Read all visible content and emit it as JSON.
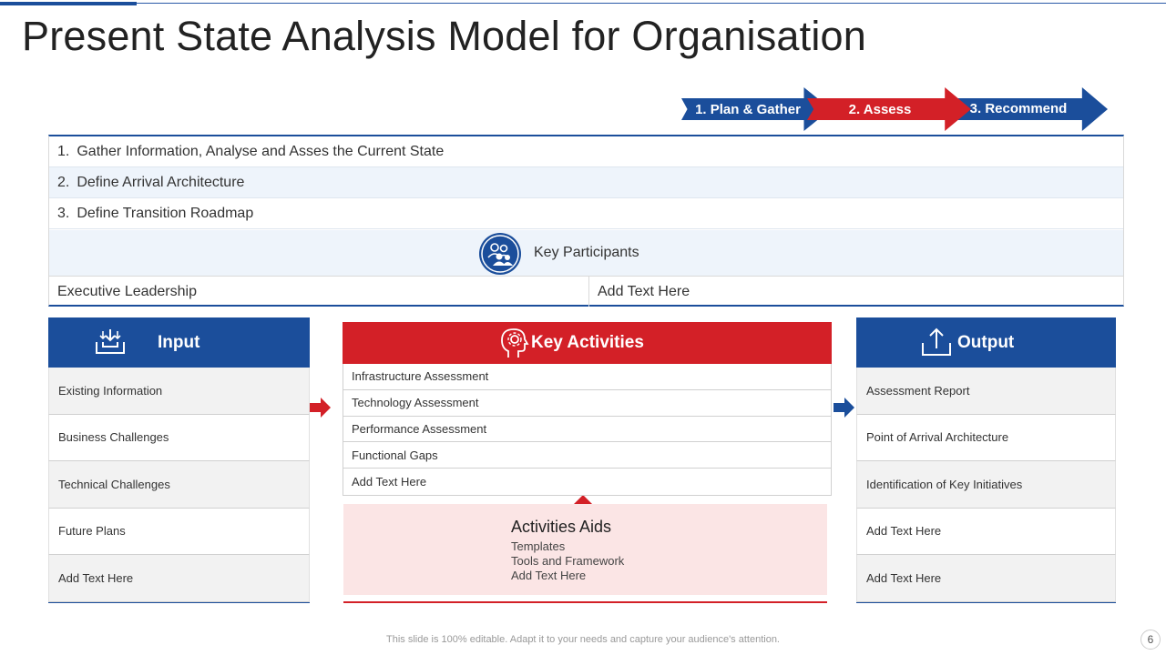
{
  "title": "Present State Analysis Model for Organisation",
  "phases": [
    {
      "label": "1. Plan & Gather",
      "color": "#1b4e9b"
    },
    {
      "label": "2. Assess",
      "color": "#d32027"
    },
    {
      "label": "3. Recommend",
      "color": "#1b4e9b"
    }
  ],
  "scope": {
    "rows": [
      {
        "num": "1.",
        "text": "Gather Information,  Analyse and Asses the Current State"
      },
      {
        "num": "2.",
        "text": "Define Arrival Architecture"
      },
      {
        "num": "3.",
        "text": "Define Transition Roadmap"
      }
    ],
    "participants_label": "Key Participants",
    "participants_icon": "team-icon",
    "participants": [
      "Executive  Leadership",
      "Add Text Here"
    ]
  },
  "input": {
    "heading": "Input",
    "icon": "inbox-download-icon",
    "items": [
      "Existing Information",
      "Business Challenges",
      "Technical Challenges",
      "Future Plans",
      "Add Text Here"
    ]
  },
  "activities": {
    "heading": "Key Activities",
    "icon": "head-gear-icon",
    "items": [
      "Infrastructure  Assessment",
      "Technology  Assessment",
      "Performance  Assessment",
      "Functional  Gaps",
      "Add Text Here"
    ]
  },
  "aids": {
    "title": "Activities Aids",
    "lines": [
      "Templates",
      "Tools  and  Framework",
      "Add Text Here"
    ]
  },
  "output": {
    "heading": "Output",
    "icon": "upload-tray-icon",
    "items": [
      "Assessment Report",
      "Point of Arrival  Architecture",
      "Identification  of Key Initiatives",
      "Add Text Here",
      "Add Text Here"
    ]
  },
  "footer": "This slide is 100% editable. Adapt it to your needs and capture your audience's attention.",
  "page_number": "6",
  "colors": {
    "blue": "#1b4e9b",
    "red": "#d32027",
    "light_blue": "#eef4fb",
    "light_red": "#fbe5e5"
  }
}
